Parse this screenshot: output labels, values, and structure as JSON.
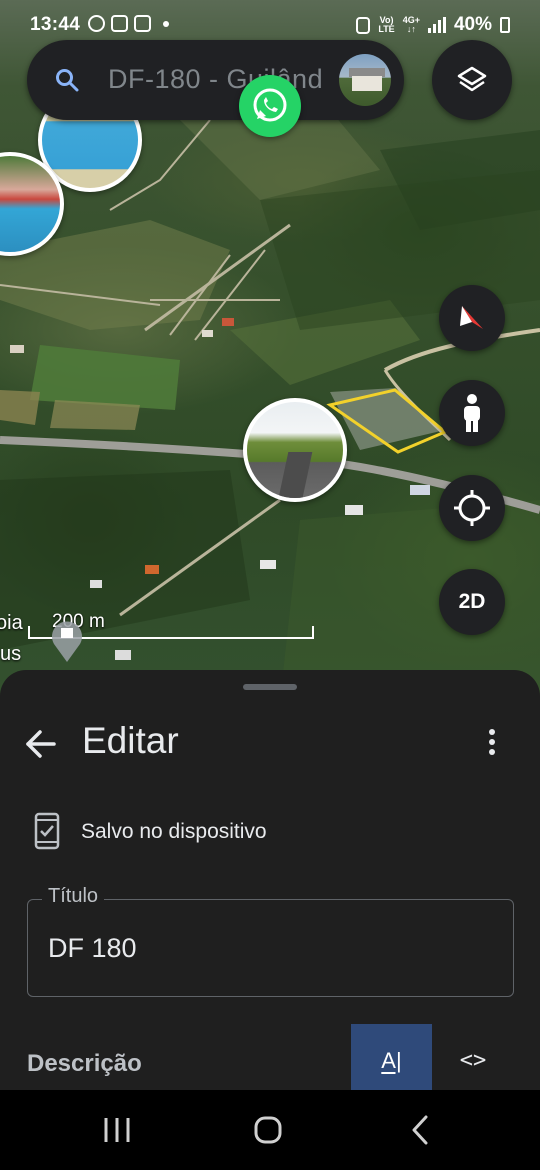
{
  "status_bar": {
    "time": "13:44",
    "battery": "40%",
    "network_top": "Vo)",
    "network_bottom": "LTE",
    "data_top": "4G+",
    "data_bottom": "↓↑"
  },
  "search": {
    "query": "DF-180 - Guilând",
    "icon": "search-icon"
  },
  "map": {
    "scale_label": "200 m",
    "place_label_1": "oia",
    "place_label_2": "us",
    "compass_color": "#e53935",
    "view_mode_button": "2D"
  },
  "sheet": {
    "title": "Editar",
    "saved_status": "Salvo no dispositivo",
    "title_field_label": "Título",
    "title_field_value": "DF 180",
    "description_label": "Descrição",
    "text_tab": "A|",
    "code_tab": "<>"
  },
  "colors": {
    "whatsapp": "#25d366",
    "sheet_bg": "#1f1f1f",
    "active_tab": "#2f4a7a",
    "boundary": "#f2d12b"
  }
}
